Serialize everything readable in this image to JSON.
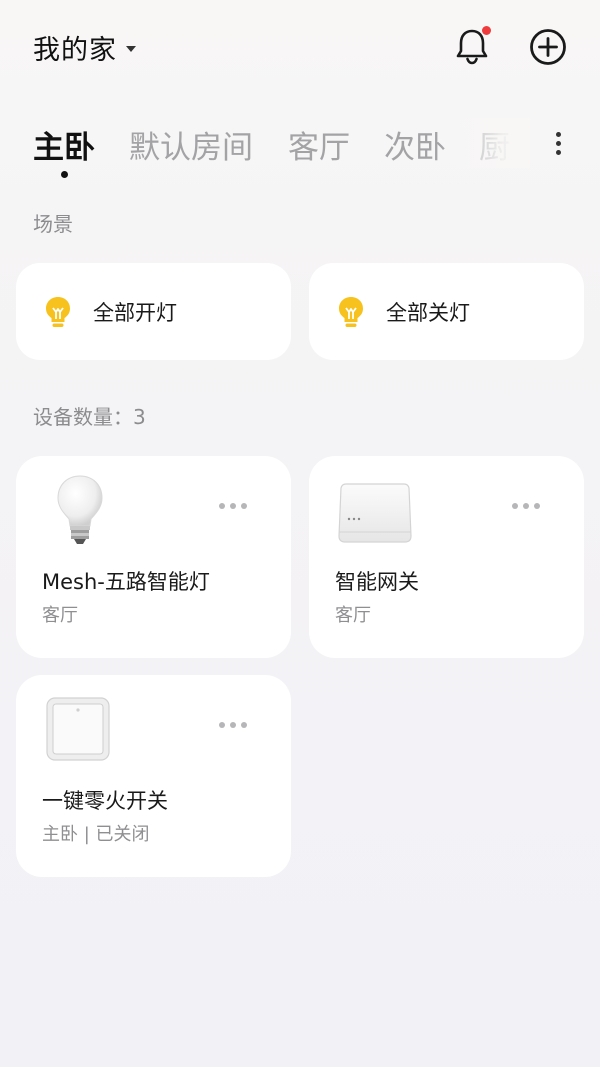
{
  "header": {
    "home_title": "我的家",
    "notification_has_unread": true
  },
  "tabs": [
    {
      "label": "主卧",
      "active": true
    },
    {
      "label": "默认房间",
      "active": false
    },
    {
      "label": "客厅",
      "active": false
    },
    {
      "label": "次卧",
      "active": false
    },
    {
      "label": "厨",
      "active": false
    }
  ],
  "scenes": {
    "section_label": "场景",
    "items": [
      {
        "label": "全部开灯",
        "icon": "bulb-icon"
      },
      {
        "label": "全部关灯",
        "icon": "bulb-icon"
      }
    ]
  },
  "devices": {
    "section_label": "设备数量：3",
    "items": [
      {
        "name": "Mesh-五路智能灯",
        "sub": "客厅",
        "icon": "smart-bulb-icon"
      },
      {
        "name": "智能网关",
        "sub": "客厅",
        "icon": "gateway-icon"
      },
      {
        "name": "一键零火开关",
        "sub": "主卧 | 已关闭",
        "icon": "wall-switch-icon"
      }
    ]
  },
  "colors": {
    "accent_yellow": "#f7c21d",
    "badge_red": "#ef3b3b",
    "text_primary": "#111111",
    "text_secondary": "#8f8f92",
    "tab_inactive": "#a3a3a6"
  }
}
